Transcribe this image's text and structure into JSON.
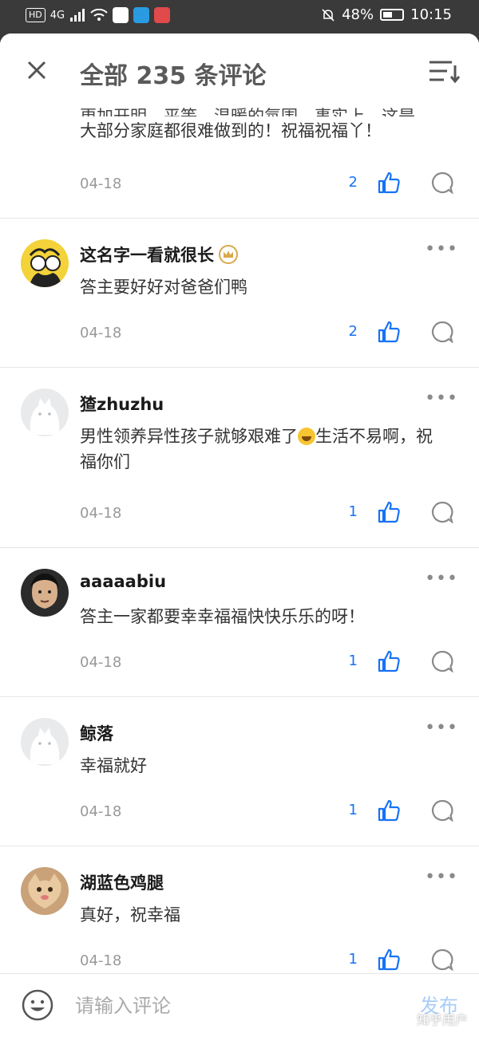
{
  "status_bar": {
    "hd": "HD",
    "network": "4G",
    "battery_percent": "48%",
    "time": "10:15"
  },
  "header": {
    "title": "全部 235 条评论"
  },
  "partial_comment": {
    "text_cut": "更加开明、平等、温暖的氛围，事实上，这是",
    "text": "大部分家庭都很难做到的！祝福祝福丫！",
    "date": "04-18",
    "likes": "2"
  },
  "comments": [
    {
      "name": "这名字一看就很长",
      "text": "答主要好好对爸爸们鸭",
      "date": "04-18",
      "likes": "2"
    },
    {
      "name": "猹zhuzhu",
      "text_before_emoji": "男性领养异性孩子就够艰难了",
      "text_after_emoji": "生活不易啊，祝福你们",
      "date": "04-18",
      "likes": "1"
    },
    {
      "name": "aaaaabiu",
      "text": "答主一家都要幸幸福福快快乐乐的呀！",
      "date": "04-18",
      "likes": "1"
    },
    {
      "name": "鲸落",
      "text": "幸福就好",
      "date": "04-18",
      "likes": "1"
    },
    {
      "name": "湖蓝色鸡腿",
      "text": "真好，祝幸福",
      "date": "04-18",
      "likes": "1"
    }
  ],
  "footer": {
    "input_placeholder": "请输入评论",
    "publish_label": "发布",
    "watermark": "知乎用户"
  },
  "colors": {
    "accent": "#1772f6",
    "publish_disabled": "#a9cdf7",
    "crown": "#d8a94b"
  }
}
